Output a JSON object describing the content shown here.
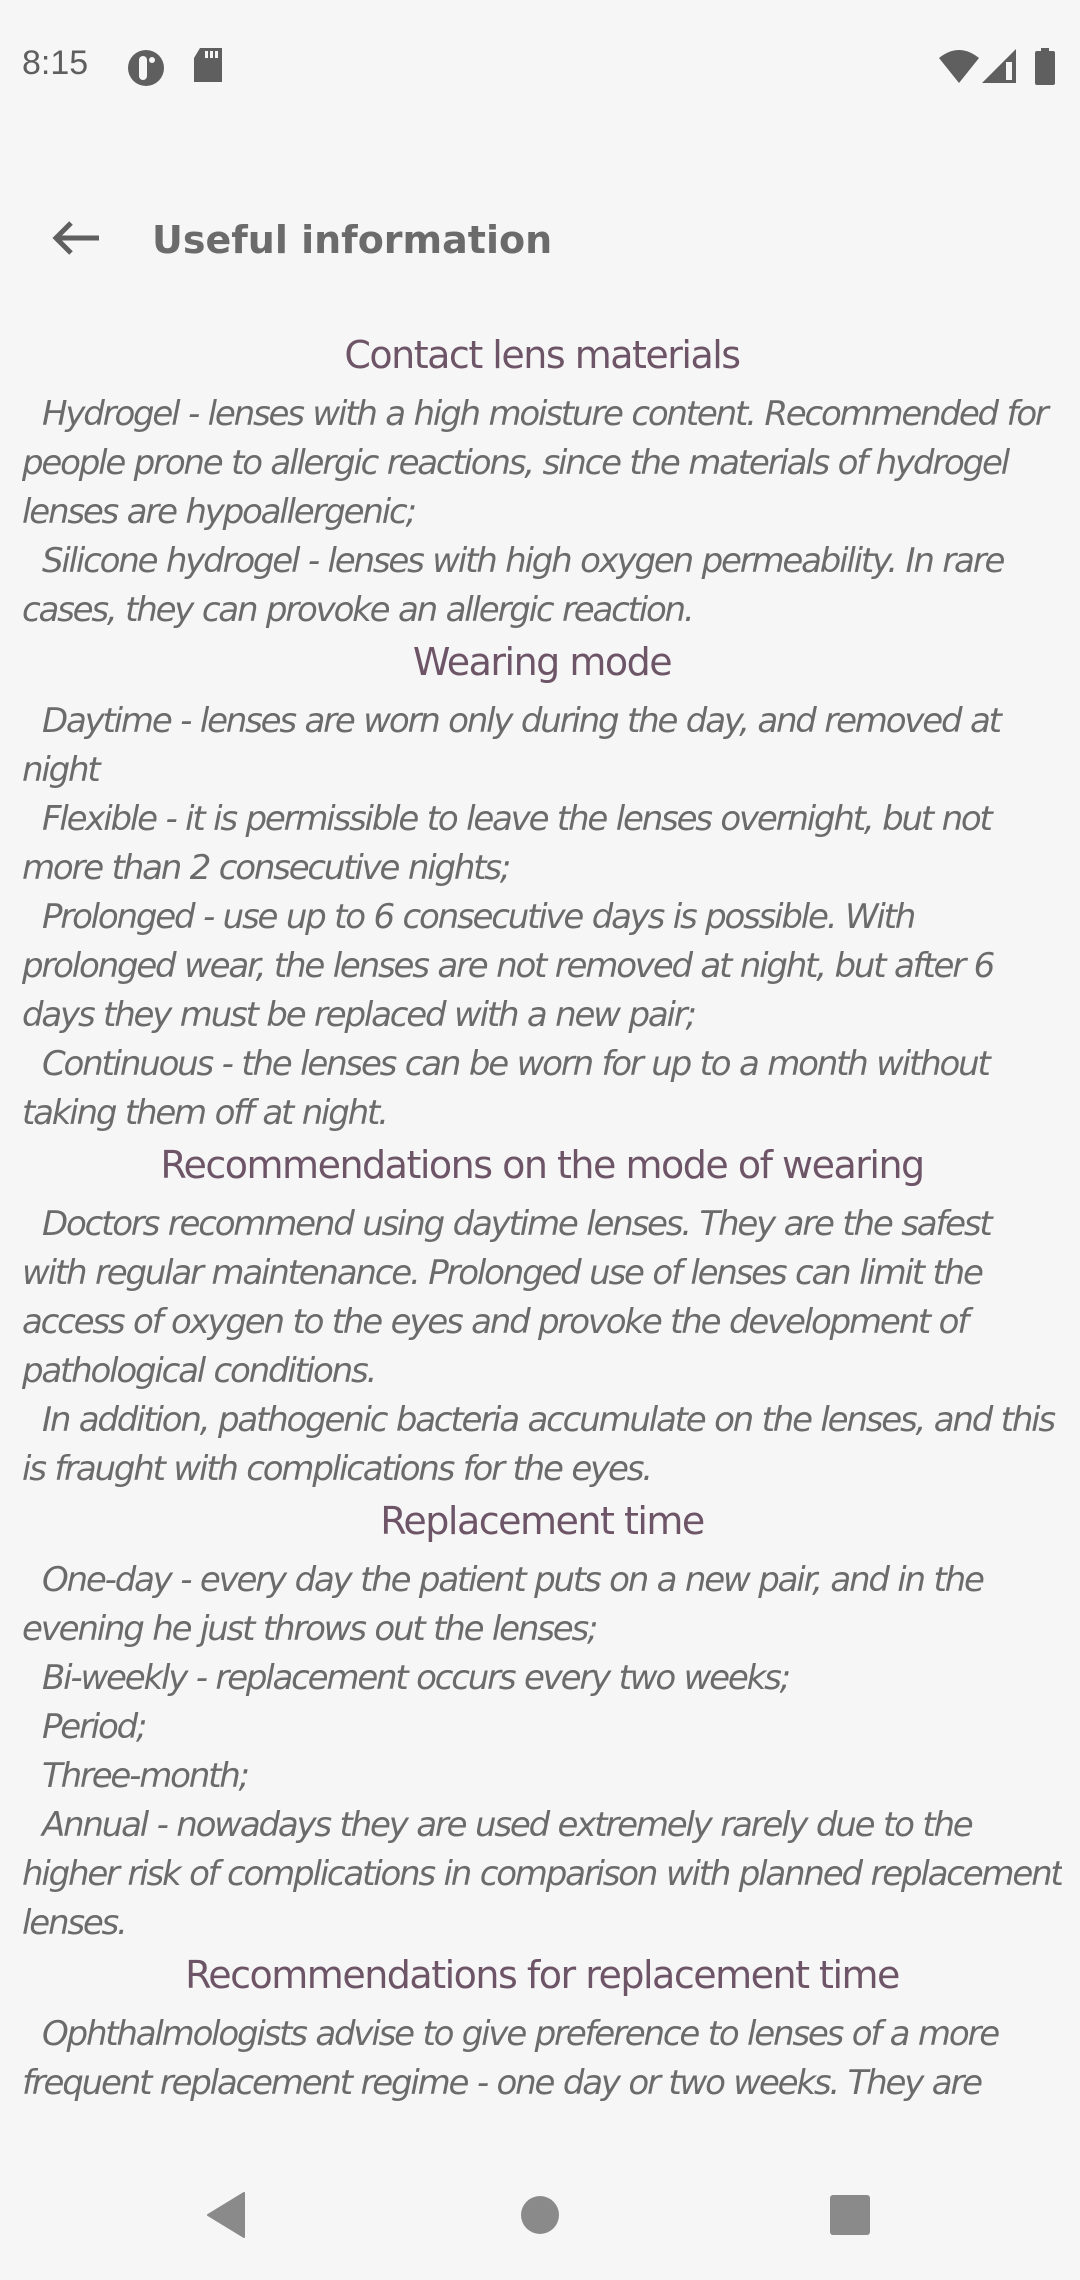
{
  "status_bar": {
    "time": "8:15",
    "left_icons": [
      "data-saver-icon",
      "sd-card-icon"
    ],
    "right_icons": [
      "wifi-icon",
      "cell-signal-icon",
      "battery-icon"
    ]
  },
  "app_bar": {
    "back_icon": "arrow-left-icon",
    "title": "Useful information"
  },
  "colors": {
    "background": "#f6f6f6",
    "heading": "#6d5567",
    "body_text": "#6b6b6b",
    "title_text": "#6b6b6b",
    "icons": "#5f5f5f"
  },
  "sections": [
    {
      "title": "Contact lens materials",
      "paragraphs": [
        "Hydrogel - lenses with a high moisture content. Recommended for people prone to allergic reactions, since the materials of hydrogel lenses are hypoallergenic;",
        "Silicone hydrogel - lenses with high oxygen permeability. In rare cases, they can provoke an allergic reaction."
      ]
    },
    {
      "title": "Wearing mode",
      "paragraphs": [
        "Daytime - lenses are worn only during the day, and removed at night",
        "Flexible - it is permissible to leave the lenses overnight, but not more than 2 consecutive nights;",
        "Prolonged - use up to 6 consecutive days is possible. With prolonged wear, the lenses are not removed at night, but after 6 days they must be replaced with a new pair;",
        "Continuous - the lenses can be worn for up to a month without taking them off at night."
      ]
    },
    {
      "title": "Recommendations on the mode of wearing",
      "paragraphs": [
        "Doctors recommend using daytime lenses. They are the safest with regular maintenance. Prolonged use of lenses can limit the access of oxygen to the eyes and provoke the development of pathological conditions.",
        "In addition, pathogenic bacteria accumulate on the lenses, and this is fraught with complications for the eyes."
      ]
    },
    {
      "title": "Replacement time",
      "paragraphs": [
        "One-day - every day the patient puts on a new pair, and in the evening he just throws out the lenses;",
        "Bi-weekly - replacement occurs every two weeks;",
        "Period;",
        "Three-month;",
        "Annual - nowadays they are used extremely rarely due to the higher risk of complications in comparison with planned replacement lenses."
      ]
    },
    {
      "title": "Recommendations for replacement time",
      "paragraphs": [
        "Ophthalmologists advise to give preference to lenses of a more frequent replacement regime - one day or two weeks. They are"
      ]
    }
  ],
  "nav_bar": {
    "back": "nav-back-icon",
    "home": "nav-home-icon",
    "recents": "nav-recents-icon"
  }
}
